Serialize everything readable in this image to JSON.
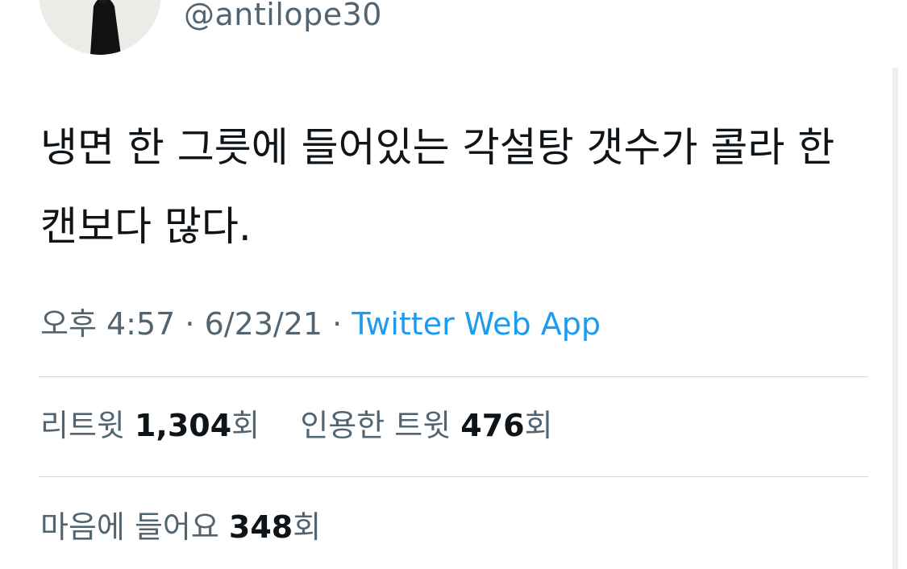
{
  "author": {
    "handle": "@antilope30",
    "avatar_icon": "profile-photo-avatar"
  },
  "tweet": {
    "text": "냉면 한 그릇에 들어있는 각설탕 갯수가 콜라 한 캔보다 많다."
  },
  "meta": {
    "time": "오후 4:57",
    "separator": " · ",
    "date": "6/23/21",
    "source": "Twitter Web App"
  },
  "stats": {
    "retweets_label": "리트윗 ",
    "retweets_count": "1,304",
    "retweets_unit": "회",
    "quotes_label": "인용한 트윗 ",
    "quotes_count": "476",
    "quotes_unit": "회",
    "likes_label": "마음에 들어요 ",
    "likes_count": "348",
    "likes_unit": "회"
  },
  "colors": {
    "text_primary": "#0f1419",
    "text_secondary": "#536471",
    "link": "#1d9bf0",
    "divider": "#cfd9de"
  }
}
